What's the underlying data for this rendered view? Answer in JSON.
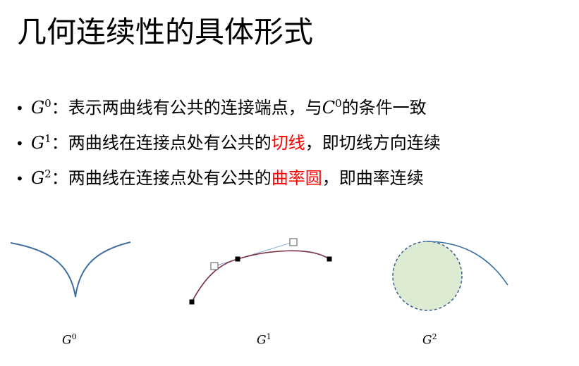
{
  "title": "几何连续性的具体形式",
  "bullets": [
    {
      "symbol": "G",
      "symbol_sup": "0",
      "text_before": "：表示两曲线有公共的连接端点，与",
      "inline_symbol": "C",
      "inline_symbol_sup": "0",
      "highlight": "",
      "text_after": "的条件一致"
    },
    {
      "symbol": "G",
      "symbol_sup": "1",
      "text_before": "：两曲线在连接点处有公共的",
      "inline_symbol": "",
      "inline_symbol_sup": "",
      "highlight": "切线",
      "text_after": "，即切线方向连续"
    },
    {
      "symbol": "G",
      "symbol_sup": "2",
      "text_before": "：两曲线在连接点处有公共的",
      "inline_symbol": "",
      "inline_symbol_sup": "",
      "highlight": "曲率圆",
      "text_after": "，即曲率连续"
    }
  ],
  "figures": [
    {
      "caption": "G",
      "caption_sup": "0"
    },
    {
      "caption": "G",
      "caption_sup": "1"
    },
    {
      "caption": "G",
      "caption_sup": "2"
    }
  ],
  "colors": {
    "highlight": "#ff0000",
    "g0_curve": "#3f6fa0",
    "g1_curve": "#7a3040",
    "g1_handle_line": "#8aaed6",
    "g2_circle_fill": "#deebd3",
    "g2_circle_stroke": "#3a5f8a",
    "g2_curve": "#3f6fa0"
  }
}
